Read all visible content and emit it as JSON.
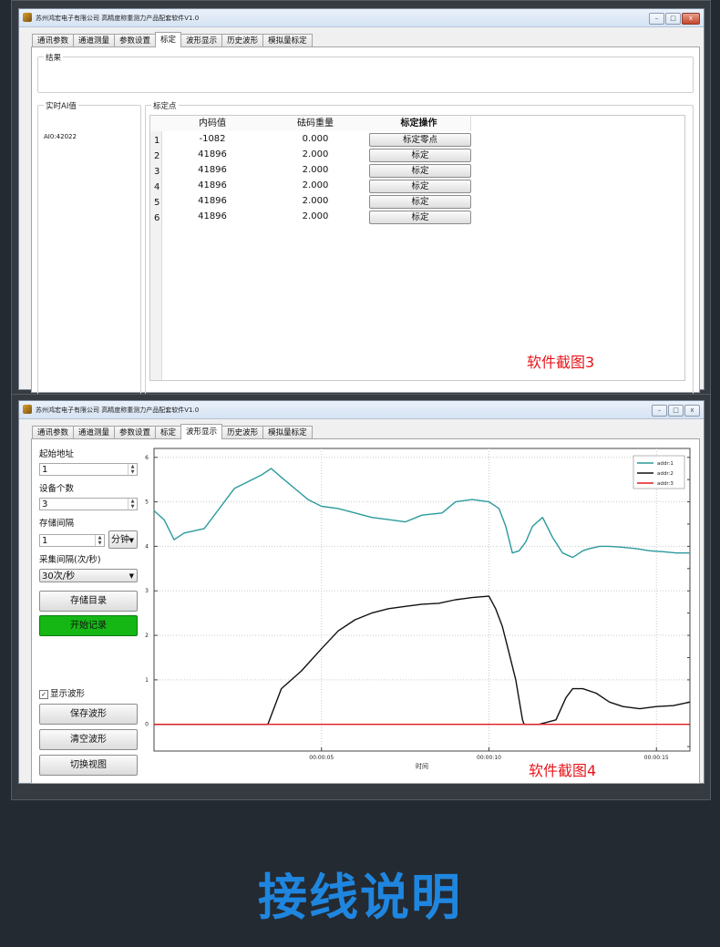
{
  "window": {
    "title": "苏州鸿宏电子有限公司 高精度称重测力产品配套软件V1.0",
    "buttons": {
      "minimize": "–",
      "maximize": "□",
      "close": "x"
    }
  },
  "tabs": [
    "通讯参数",
    "通道测量",
    "参数设置",
    "标定",
    "波形显示",
    "历史波形",
    "模拟量标定"
  ],
  "screen3": {
    "active_tab": "标定",
    "result_label": "结果",
    "realtime_label": "实时AI值",
    "realtime_value": "AI0:42022",
    "calib_label": "标定点",
    "table": {
      "headers": [
        "内码值",
        "砝码重量",
        "标定操作"
      ],
      "rows": [
        {
          "num": "1",
          "code": "-1082",
          "weight": "0.000",
          "action": "标定零点"
        },
        {
          "num": "2",
          "code": "41896",
          "weight": "2.000",
          "action": "标定"
        },
        {
          "num": "3",
          "code": "41896",
          "weight": "2.000",
          "action": "标定"
        },
        {
          "num": "4",
          "code": "41896",
          "weight": "2.000",
          "action": "标定"
        },
        {
          "num": "5",
          "code": "41896",
          "weight": "2.000",
          "action": "标定"
        },
        {
          "num": "6",
          "code": "41896",
          "weight": "2.000",
          "action": "标定"
        }
      ]
    },
    "caption": "软件截图3"
  },
  "screen4": {
    "active_tab": "波形显示",
    "start_addr_label": "起始地址",
    "start_addr_value": "1",
    "device_count_label": "设备个数",
    "device_count_value": "3",
    "store_interval_label": "存储间隔",
    "store_interval_value": "1",
    "store_interval_unit": "分钟",
    "sample_interval_label": "采集间隔(次/秒)",
    "sample_interval_value": "30次/秒",
    "store_dir_button": "存储目录",
    "start_record_button": "开始记录",
    "show_wave_label": "显示波形",
    "show_wave_checked": true,
    "save_wave_button": "保存波形",
    "clear_wave_button": "清空波形",
    "switch_view_button": "切换视图",
    "caption": "软件截图4"
  },
  "chart_data": {
    "type": "line",
    "xlabel": "时间",
    "ylabel": "",
    "x_ticks": [
      "00:00:05",
      "00:00:10",
      "00:00:15"
    ],
    "x_tick_values": [
      5,
      10,
      15
    ],
    "xlim": [
      0,
      16
    ],
    "ylim": [
      -0.6,
      6.2
    ],
    "y_ticks": [
      0,
      1,
      2,
      3,
      4,
      5,
      6
    ],
    "grid": true,
    "legend_position": "top-right",
    "series": [
      {
        "name": "addr:1",
        "color": "#2a9a9c",
        "x": [
          0,
          0.3,
          0.6,
          0.9,
          1.5,
          2.0,
          2.4,
          2.8,
          3.2,
          3.5,
          3.8,
          4.2,
          4.6,
          5.0,
          5.5,
          6.0,
          6.5,
          7.0,
          7.5,
          8.0,
          8.6,
          9.0,
          9.5,
          10.0,
          10.3,
          10.5,
          10.7,
          10.9,
          11.1,
          11.3,
          11.6,
          11.9,
          12.2,
          12.5,
          12.8,
          13.0,
          13.3,
          13.6,
          14.0,
          14.4,
          14.8,
          15.2,
          15.6,
          16.0
        ],
        "y": [
          4.8,
          4.6,
          4.15,
          4.3,
          4.4,
          4.9,
          5.3,
          5.45,
          5.6,
          5.75,
          5.55,
          5.3,
          5.05,
          4.9,
          4.85,
          4.75,
          4.65,
          4.6,
          4.55,
          4.7,
          4.75,
          5.0,
          5.05,
          5.0,
          4.85,
          4.45,
          3.85,
          3.9,
          4.1,
          4.45,
          4.65,
          4.2,
          3.85,
          3.75,
          3.9,
          3.95,
          4.0,
          4.0,
          3.98,
          3.95,
          3.9,
          3.88,
          3.85,
          3.85
        ]
      },
      {
        "name": "addr:2",
        "color": "#111111",
        "x": [
          0,
          3.4,
          3.8,
          4.4,
          5.0,
          5.5,
          6.0,
          6.5,
          7.0,
          7.5,
          8.0,
          8.5,
          9.0,
          9.5,
          10.0,
          10.2,
          10.4,
          10.6,
          10.8,
          11.0,
          11.05,
          11.1,
          11.2,
          11.5,
          12.0,
          12.3,
          12.5,
          12.8,
          13.2,
          13.6,
          14.0,
          14.5,
          15.0,
          15.5,
          16.0
        ],
        "y": [
          0,
          0,
          0.8,
          1.2,
          1.7,
          2.1,
          2.35,
          2.5,
          2.6,
          2.65,
          2.7,
          2.72,
          2.8,
          2.85,
          2.88,
          2.6,
          2.2,
          1.6,
          1.0,
          0.1,
          0.0,
          0.0,
          0.0,
          0.0,
          0.1,
          0.6,
          0.8,
          0.8,
          0.7,
          0.5,
          0.4,
          0.35,
          0.4,
          0.42,
          0.5
        ]
      },
      {
        "name": "addr:3",
        "color": "#e21b1b",
        "x": [
          0,
          16
        ],
        "y": [
          0,
          0
        ]
      }
    ]
  }
}
